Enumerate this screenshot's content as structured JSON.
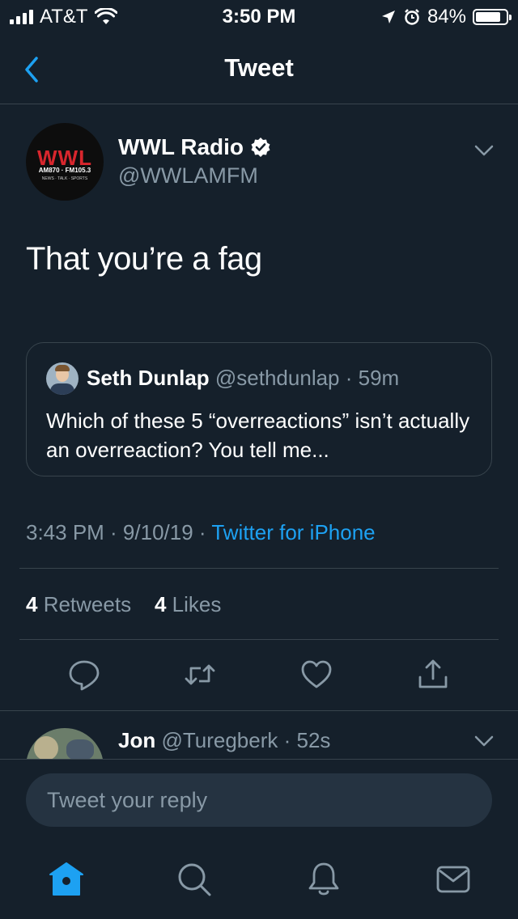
{
  "status_bar": {
    "carrier": "AT&T",
    "time": "3:50 PM",
    "battery": "84%",
    "battery_level": 0.84
  },
  "header": {
    "title": "Tweet",
    "back_icon": "chevron-left-icon"
  },
  "tweet": {
    "author_name": "WWL Radio",
    "author_handle": "@WWLAMFM",
    "avatar_logo": "WWL",
    "avatar_sub": "AM870 · FM105.3",
    "avatar_sub2": "NEWS · TALK · SPORTS",
    "text": "That you’re a fag",
    "timestamp": "3:43 PM · 9/10/19 · ",
    "source": "Twitter for iPhone",
    "retweet_count": "4",
    "retweet_label": " Retweets",
    "like_count": "4",
    "like_label": " Likes"
  },
  "quoted_tweet": {
    "name": "Seth Dunlap",
    "handle": " @sethdunlap · 59m",
    "text": "Which of these 5 “overreactions” isn’t actually an overreaction?  You tell me..."
  },
  "actions": [
    "reply-icon",
    "retweet-icon",
    "like-icon",
    "share-icon"
  ],
  "reply_preview": {
    "name": "Jon",
    "handle": " @Turegberk · 52s"
  },
  "reply_box": {
    "placeholder": "Tweet your reply"
  },
  "tab_bar": [
    "home-icon",
    "search-icon",
    "notifications-icon",
    "messages-icon"
  ],
  "colors": {
    "background": "#15202b",
    "accent": "#1da1f2",
    "secondary_text": "#8899a6",
    "border": "#38444d"
  }
}
